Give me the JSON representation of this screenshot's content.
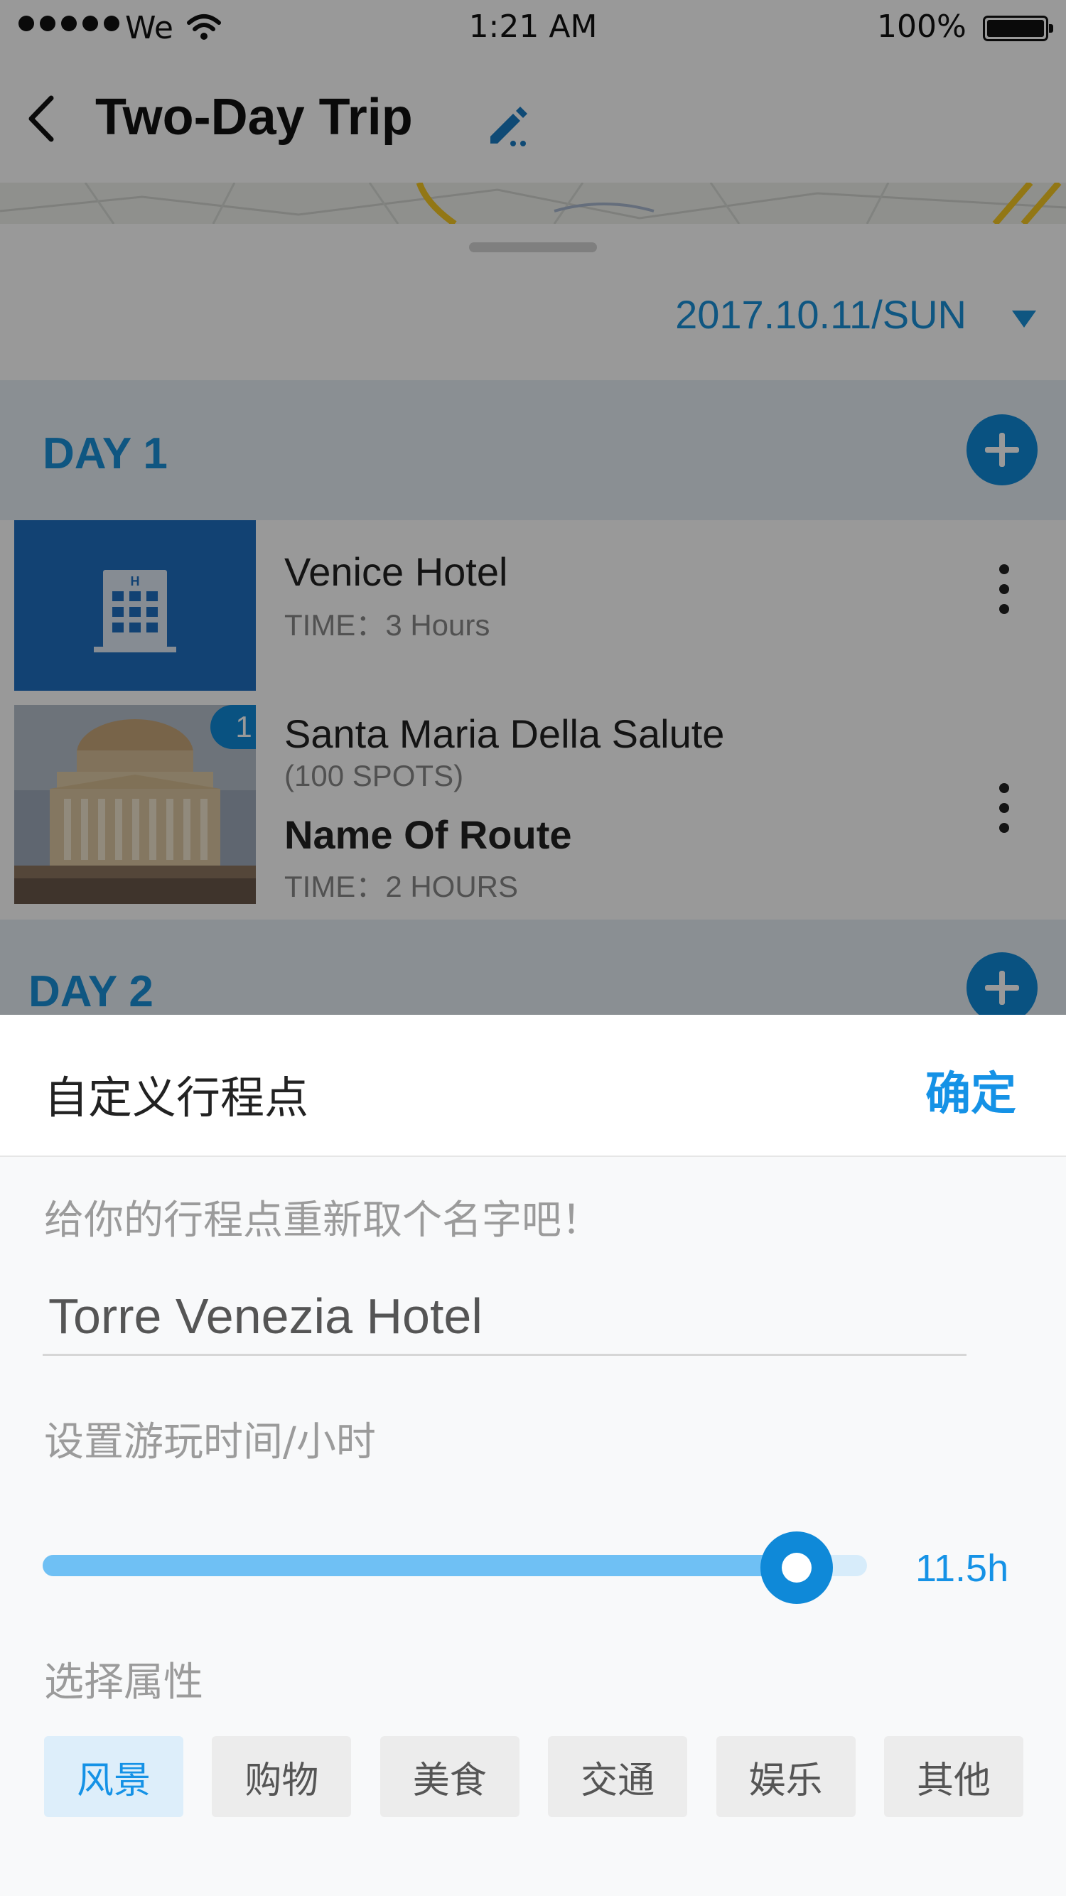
{
  "status_bar": {
    "carrier": "We",
    "time": "1:21 AM",
    "battery": "100%"
  },
  "nav": {
    "title": "Two-Day Trip"
  },
  "date_selector": {
    "value": "2017.10.11/SUN"
  },
  "days": [
    {
      "label": "DAY 1"
    },
    {
      "label": "DAY 2"
    }
  ],
  "items": [
    {
      "name": "Venice Hotel",
      "time": "TIME：3 Hours"
    },
    {
      "badge": "1",
      "name": "Santa Maria Della Salute",
      "spots": "(100 SPOTS)",
      "route": "Name Of Route",
      "time": "TIME：2 HOURS"
    }
  ],
  "panel": {
    "title": "自定义行程点",
    "confirm": "确定",
    "name_hint": "给你的行程点重新取个名字吧！",
    "name_value": "Torre Venezia Hotel",
    "time_label": "设置游玩时间/小时",
    "slider": {
      "value_label": "11.5h",
      "fraction": 0.915
    },
    "attr_label": "选择属性",
    "tags": [
      "风景",
      "购物",
      "美食",
      "交通",
      "娱乐",
      "其他"
    ],
    "selected_tag": "风景"
  },
  "colors": {
    "accent": "#1592e6",
    "slider_fill": "#6fc0f4",
    "tag_selected_bg": "#ddeefa"
  }
}
